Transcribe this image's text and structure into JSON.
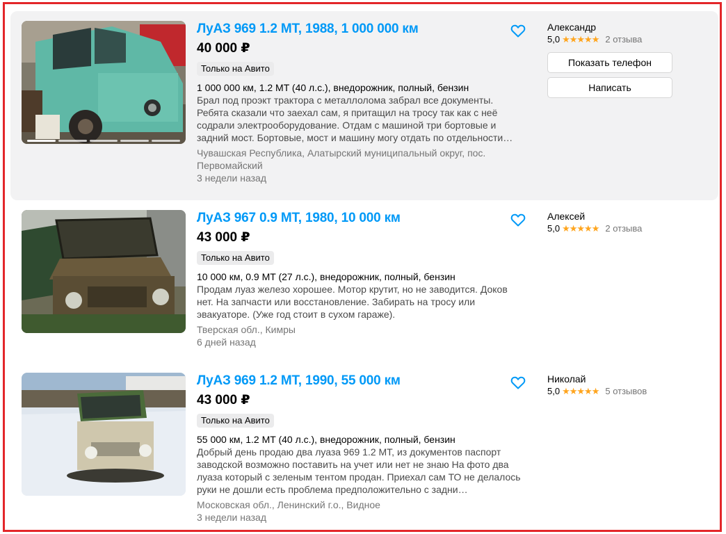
{
  "listings": [
    {
      "title": "ЛуАЗ 969 1.2 MT, 1988, 1 000 000 км",
      "price": "40 000 ₽",
      "badge": "Только на Авито",
      "params": "1 000 000 км, 1.2 MT (40 л.с.), внедорожник, полный, бензин",
      "description": "Брал под проэкт трактора с металлолома забрал все документы. Ребята сказали что заехал сам, я притащил на тросу так как с неё содрали электрооборудование. Отдам с машиной три бортовые и задний мост. Бортовые, мост и машину могу отдать по отдельности…",
      "location": "Чувашская Республика, Алатырский муниципальный округ, пос. Первомайский",
      "date": "3 недели назад",
      "seller": {
        "name": "Александр",
        "rating": "5,0",
        "stars": "★★★★★",
        "reviews": "2 отзыва"
      },
      "buttons": {
        "phone": "Показать телефон",
        "write": "Написать"
      },
      "photo": "green-luaz-car-photo"
    },
    {
      "title": "ЛуАЗ 967 0.9 MT, 1980, 10 000 км",
      "price": "43 000 ₽",
      "badge": "Только на Авито",
      "params": "10 000 км, 0.9 MT (27 л.с.), внедорожник, полный, бензин",
      "description": "Продам луаз железо хорошее. Мотор крутит, но не заводится. Доков нет. На запчасти или восстановление. Забирать на тросу или эвакуаторе. (Уже год стоит в сухом гараже).",
      "location": "Тверская обл., Кимры",
      "date": "6 дней назад",
      "seller": {
        "name": "Алексей",
        "rating": "5,0",
        "stars": "★★★★★",
        "reviews": "2 отзыва"
      },
      "photo": "brown-luaz-car-photo"
    },
    {
      "title": "ЛуАЗ 969 1.2 MT, 1990, 55 000 км",
      "price": "43 000 ₽",
      "badge": "Только на Авито",
      "params": "55 000 км, 1.2 MT (40 л.с.), внедорожник, полный, бензин",
      "description": "Добрый день продаю два луаза 969 1.2 МТ, из документов паспорт заводской возможно поставить на учет или нет не знаю На фото два луаза который с зеленым тентом продан. Приехал сам ТО не делалось руки не дошли есть проблема предположительно с задни…",
      "location": "Московская обл., Ленинский г.о., Видное",
      "date": "3 недели назад",
      "seller": {
        "name": "Николай",
        "rating": "5,0",
        "stars": "★★★★★",
        "reviews": "5 отзывов"
      },
      "photo": "beige-luaz-snow-photo"
    }
  ],
  "colors": {
    "title": "#0099f7",
    "stars": "#ffa51e",
    "border": "#e3262a",
    "highlight": "#f2f2f3"
  },
  "icons": {
    "favorite": "heart-outline-icon"
  }
}
